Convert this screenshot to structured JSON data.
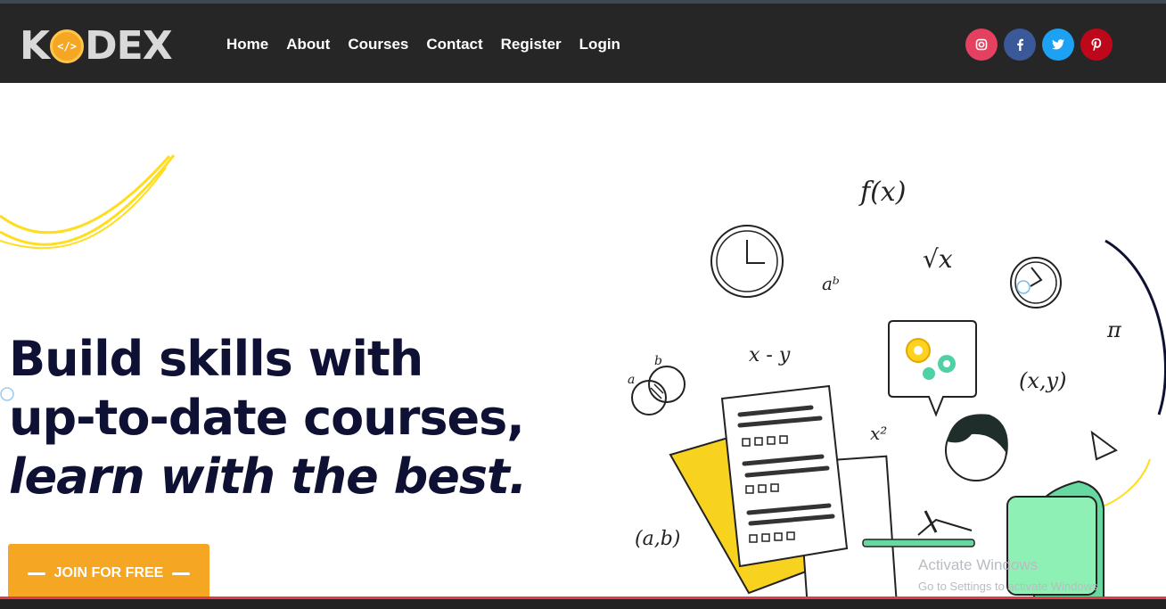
{
  "brand": {
    "logo_left": "K",
    "logo_coin": "</>",
    "logo_right": "DEX"
  },
  "nav": {
    "items": [
      {
        "label": "Home"
      },
      {
        "label": "About"
      },
      {
        "label": "Courses"
      },
      {
        "label": "Contact"
      },
      {
        "label": "Register"
      },
      {
        "label": "Login"
      }
    ]
  },
  "social": [
    {
      "icon": "instagram-icon",
      "glyph": "◎",
      "color": "#e4405f"
    },
    {
      "icon": "facebook-icon",
      "glyph": "f",
      "color": "#3b5998"
    },
    {
      "icon": "twitter-icon",
      "glyph": "🐦",
      "color": "#1da1f2"
    },
    {
      "icon": "pinterest-icon",
      "glyph": "P",
      "color": "#bd081c"
    }
  ],
  "hero": {
    "line1": "Build skills with",
    "line2": "up-to-date courses,",
    "line3": "learn with the best.",
    "cta_label": "JOIN FOR FREE"
  },
  "illustration": {
    "formulas": [
      "f(x)",
      "√x",
      "aᵇ",
      "x - y",
      "x²",
      "π",
      "(x,y)",
      "(a,b)",
      "a",
      "b"
    ]
  },
  "watermark": {
    "line1": "Activate Windows",
    "line2": "Go to Settings to activate Windows."
  },
  "colors": {
    "accent": "#f5a623",
    "dark": "#0e1133",
    "nav_bg": "#262626"
  }
}
